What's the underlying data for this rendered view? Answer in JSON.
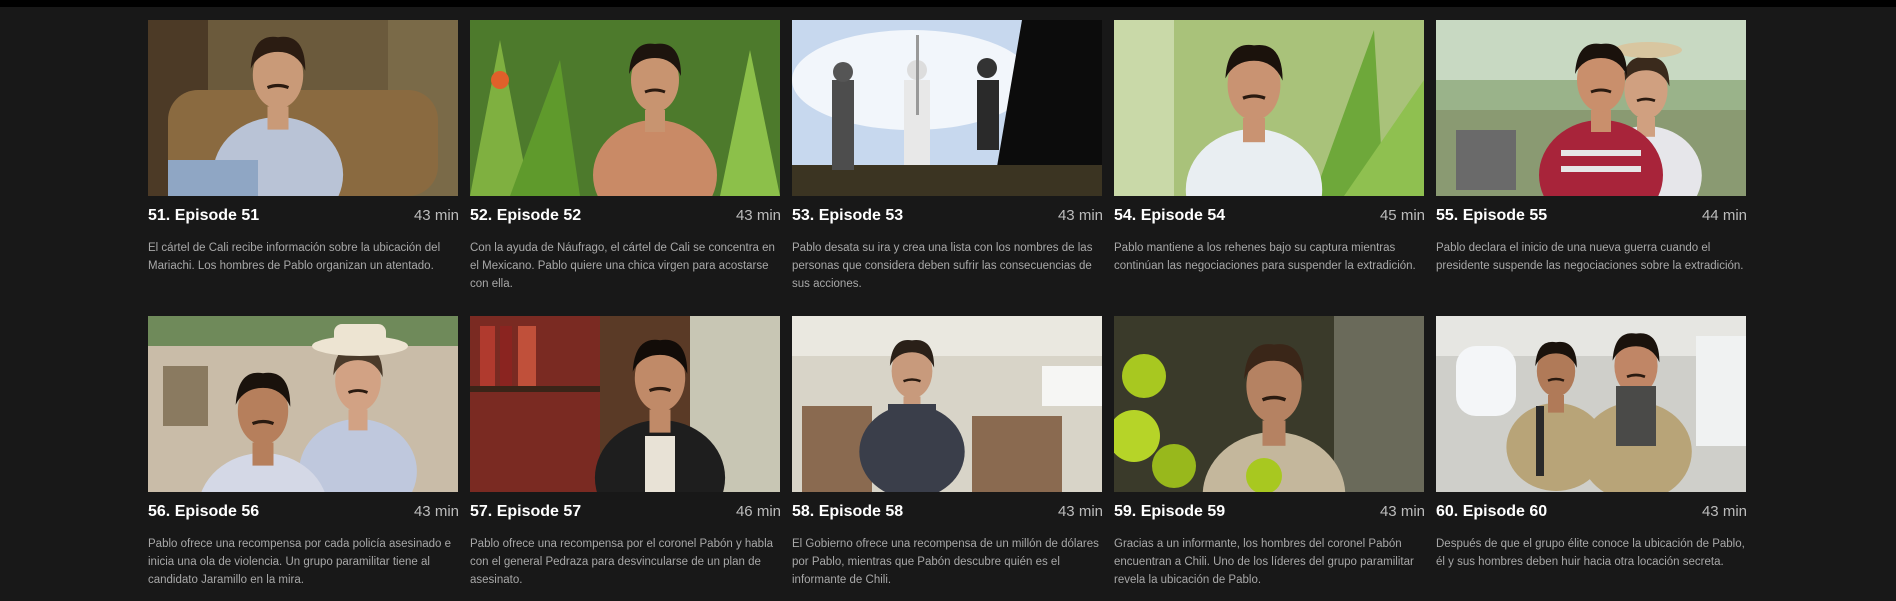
{
  "episodes": [
    {
      "title": "51. Episode 51",
      "duration": "43 min",
      "description": "El cártel de Cali recibe información sobre la ubicación del Mariachi. Los hombres de Pablo organizan un atentado.",
      "scene": "man-chair"
    },
    {
      "title": "52. Episode 52",
      "duration": "43 min",
      "description": "Con la ayuda de Náufrago, el cártel de Cali se concentra en el Mexicano. Pablo quiere una chica virgen para acostarse con ella.",
      "scene": "man-jungle"
    },
    {
      "title": "53. Episode 53",
      "duration": "43 min",
      "description": "Pablo desata su ira y crea una lista con los nombres de las personas que considera deben sufrir las consecuencias de sus acciones.",
      "scene": "sky-figures"
    },
    {
      "title": "54. Episode 54",
      "duration": "45 min",
      "description": "Pablo mantiene a los rehenes bajo su captura mientras continúan las negociaciones para suspender la extradición.",
      "scene": "man-plants"
    },
    {
      "title": "55. Episode 55",
      "duration": "44 min",
      "description": "Pablo declara el inicio de una nueva guerra cuando el presidente suspende las negociaciones sobre la extradición.",
      "scene": "two-men-outdoor"
    },
    {
      "title": "56. Episode 56",
      "duration": "43 min",
      "description": "Pablo ofrece una recompensa por cada policía asesinado e inicia una ola de violencia. Un grupo paramilitar tiene al candidato Jaramillo en la mira.",
      "scene": "two-men-hat"
    },
    {
      "title": "57. Episode 57",
      "duration": "46 min",
      "description": "Pablo ofrece una recompensa por el coronel Pabón y habla con el general Pedraza para desvincularse de un plan de asesinato.",
      "scene": "man-leather"
    },
    {
      "title": "58. Episode 58",
      "duration": "43 min",
      "description": "El Gobierno ofrece una recompensa de un millón de dólares por Pablo, mientras que Pabón descubre quién es el informante de Chili.",
      "scene": "plane-suit"
    },
    {
      "title": "59. Episode 59",
      "duration": "43 min",
      "description": "Gracias a un informante, los hombres del coronel Pabón encuentran a Chili. Uno de los líderes del grupo paramilitar revela la ubicación de Pablo.",
      "scene": "man-leaves"
    },
    {
      "title": "60. Episode 60",
      "duration": "43 min",
      "description": "Después de que el grupo élite conoce la ubicación de Pablo, él y sus hombres deben huir hacia otra locación secreta.",
      "scene": "helicopter-soldiers"
    }
  ]
}
